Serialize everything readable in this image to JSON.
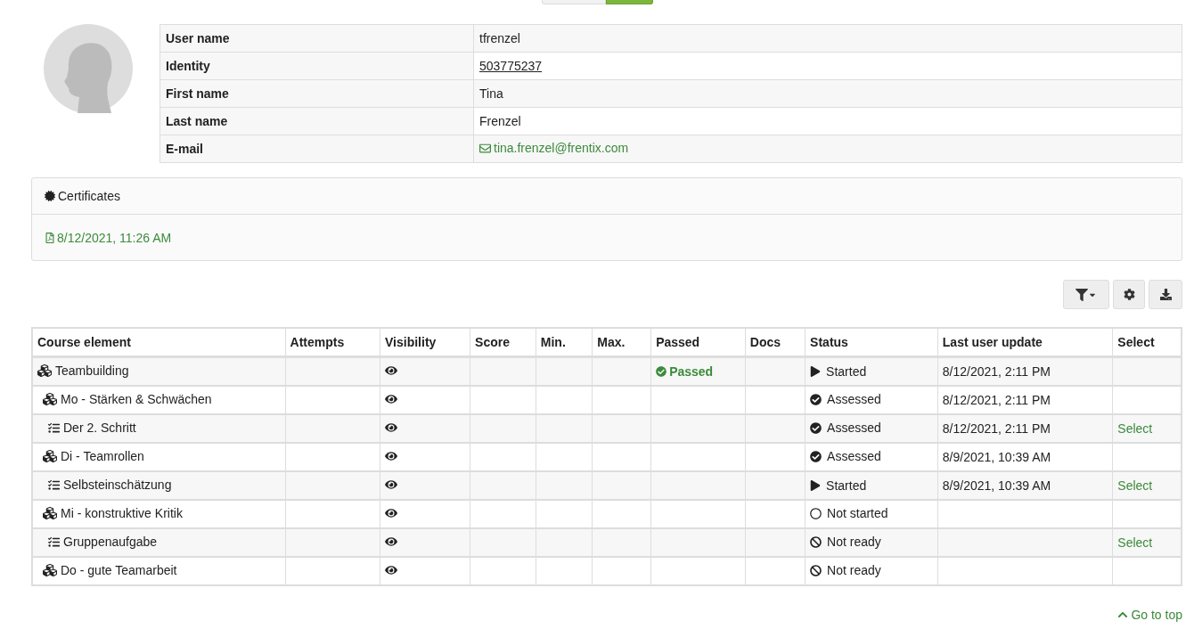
{
  "top_toggle": [
    {
      "selected": false
    },
    {
      "selected": true
    }
  ],
  "profile": [
    {
      "label": "User name",
      "value": "tfrenzel",
      "kind": "text"
    },
    {
      "label": "Identity",
      "value": "503775237",
      "kind": "underlined"
    },
    {
      "label": "First name",
      "value": "Tina",
      "kind": "text"
    },
    {
      "label": "Last name",
      "value": "Frenzel",
      "kind": "text"
    },
    {
      "label": "E-mail",
      "value": "tina.frenzel@frentix.com",
      "kind": "email"
    }
  ],
  "certificates": {
    "title": "Certificates",
    "items": [
      "8/12/2021, 11:26 AM"
    ]
  },
  "table": {
    "columns": [
      "Course element",
      "Attempts",
      "Visibility",
      "Score",
      "Min.",
      "Max.",
      "Passed",
      "Docs",
      "Status",
      "Last user update",
      "Select"
    ],
    "rows": [
      {
        "name": "Teambuilding",
        "kind": "structure",
        "passed": "Passed",
        "status": {
          "label": "Started",
          "kind": "started"
        },
        "updated": "8/12/2021, 2:11 PM",
        "children": [
          {
            "name": "Mo - Stärken & Schwächen",
            "kind": "structure",
            "status": {
              "label": "Assessed",
              "kind": "assessed"
            },
            "updated": "8/12/2021, 2:11 PM",
            "children": [
              {
                "name": "Der 2. Schritt",
                "kind": "task",
                "status": {
                  "label": "Assessed",
                  "kind": "assessed"
                },
                "updated": "8/12/2021, 2:11 PM",
                "select": "Select"
              }
            ]
          },
          {
            "name": "Di - Teamrollen",
            "kind": "structure",
            "status": {
              "label": "Assessed",
              "kind": "assessed"
            },
            "updated": "8/9/2021, 10:39 AM",
            "children": [
              {
                "name": "Selbsteinschätzung",
                "kind": "task",
                "status": {
                  "label": "Started",
                  "kind": "started"
                },
                "updated": "8/9/2021, 10:39 AM",
                "select": "Select"
              }
            ]
          },
          {
            "name": "Mi - konstruktive Kritik",
            "kind": "structure",
            "status": {
              "label": "Not started",
              "kind": "not_started"
            },
            "children": [
              {
                "name": "Gruppenaufgabe",
                "kind": "task",
                "status": {
                  "label": "Not ready",
                  "kind": "not_ready"
                },
                "select": "Select"
              }
            ]
          },
          {
            "name": "Do - gute Teamarbeit",
            "kind": "structure",
            "status": {
              "label": "Not ready",
              "kind": "not_ready"
            }
          }
        ]
      }
    ]
  },
  "go_to_top": "Go to top"
}
